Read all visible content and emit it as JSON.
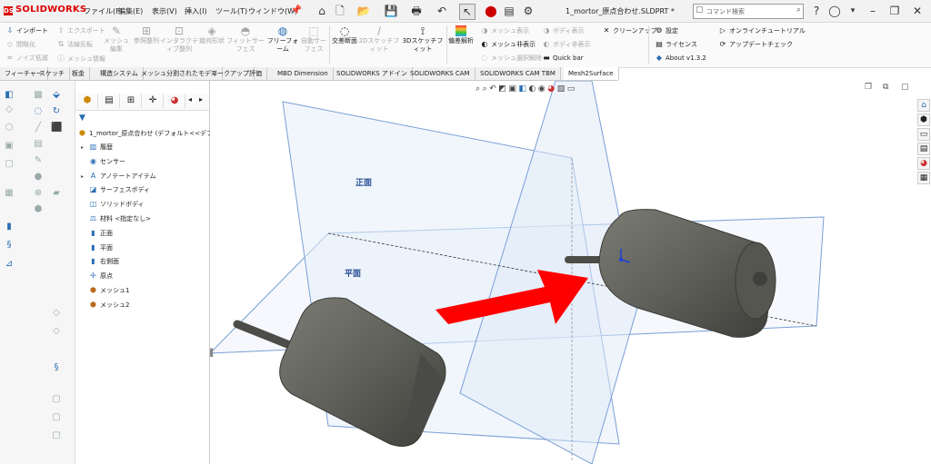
{
  "app": {
    "brand": "SOLIDWORKS",
    "document_title": "1_mortor_原点合わせ.SLDPRT *"
  },
  "menu": [
    "ファイル(F)",
    "編集(E)",
    "表示(V)",
    "挿入(I)",
    "ツール(T)",
    "ウィンドウ(W)"
  ],
  "search": {
    "placeholder": "コマンド検索"
  },
  "command_manager": {
    "col1": [
      "インポート",
      "間略化",
      "ノイズ低減"
    ],
    "col2": [
      "エクスポート",
      "法線反転",
      "メッシュ情報"
    ],
    "big_buttons": [
      {
        "label": "メッシュ編集",
        "dim": true
      },
      {
        "label": "参照整列",
        "dim": true
      },
      {
        "label": "インタラクティブ整列",
        "dim": true
      },
      {
        "label": "幾何形状",
        "dim": true
      },
      {
        "label": "フィットサーフェス",
        "dim": true
      },
      {
        "label": "フリーフォーム",
        "dim": false
      },
      {
        "label": "自動サーフェス",
        "dim": true
      },
      {
        "label": "交差断面",
        "dim": false
      },
      {
        "label": "2Dスケッチフィット",
        "dim": true
      },
      {
        "label": "3Dスケッチフィット",
        "dim": false
      },
      {
        "label": "偏差解析",
        "dim": false
      }
    ],
    "col3": [
      "メッシュ表示",
      "メッシュ非表示",
      "メッシュ選択解除"
    ],
    "col4": [
      "ボディ表示",
      "ボディ非表示",
      "Quick bar"
    ],
    "cleanup": "クリーンアップ",
    "col5": [
      "設定",
      "ライセンス",
      "About v1.3.2"
    ],
    "col6": [
      "オンラインチュートリアル",
      "アップデートチェック"
    ]
  },
  "tabs": [
    "フィーチャー",
    "スケッチ",
    "板金",
    "構造システム",
    "メッシュ分割されたモデル",
    "マークアップ",
    "評価",
    "MBD Dimension",
    "SOLIDWORKS アドイン",
    "SOLIDWORKS CAM",
    "SOLIDWORKS CAM TBM",
    "Mesh2Surface"
  ],
  "tree": {
    "root": "1_mortor_原点合わせ (デフォルト<<デフォルト",
    "items": [
      {
        "label": "履歴",
        "icon": "history-icon",
        "arrow": true
      },
      {
        "label": "センサー",
        "icon": "sensor-icon",
        "arrow": false
      },
      {
        "label": "アノテートアイテム",
        "icon": "annotation-icon",
        "arrow": true
      },
      {
        "label": "サーフェスボディ",
        "icon": "surface-body-icon",
        "arrow": false
      },
      {
        "label": "ソリッドボディ",
        "icon": "solid-body-icon",
        "arrow": false
      },
      {
        "label": "材料 <指定なし>",
        "icon": "material-icon",
        "arrow": false
      },
      {
        "label": "正面",
        "icon": "plane-icon",
        "arrow": false
      },
      {
        "label": "平面",
        "icon": "plane-icon",
        "arrow": false
      },
      {
        "label": "右側面",
        "icon": "plane-icon",
        "arrow": false
      },
      {
        "label": "原点",
        "icon": "origin-icon",
        "arrow": false
      },
      {
        "label": "メッシュ1",
        "icon": "mesh-icon",
        "arrow": false
      },
      {
        "label": "メッシュ2",
        "icon": "mesh-icon",
        "arrow": false
      }
    ]
  },
  "viewport": {
    "front_plane_label": "正面",
    "top_plane_label": "平面",
    "arrow_color": "#ff0000",
    "plane_color": "#7a9fd6",
    "motor_color": "#5f605a"
  },
  "colors": {
    "accent": "#2a6db3",
    "brand_red": "#d00000"
  }
}
